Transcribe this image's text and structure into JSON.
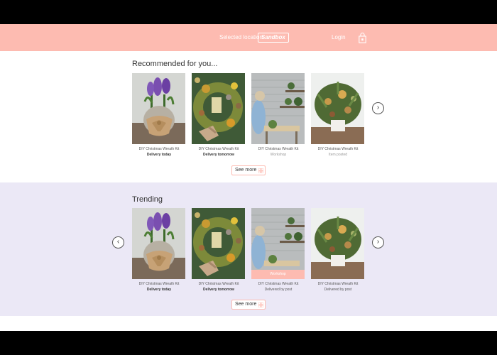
{
  "header": {
    "location_label": "Selected location",
    "location_value": "Sandbox",
    "login_label": "Login",
    "bag_icon": "shopping-bag-icon",
    "bg_color": "#fdbbb1"
  },
  "recommended": {
    "title": "Recommended for you...",
    "see_more_label": "See more",
    "cards": [
      {
        "name": "DIY Christmas Wreath Kit",
        "sub": "Delivery today",
        "image": "hyacinth-pot"
      },
      {
        "name": "DIY Christmas Wreath Kit",
        "sub": "Delivery tomorrow",
        "image": "wreath"
      },
      {
        "name": "DIY Christmas Wreath Kit",
        "sub": "Workshop",
        "image": "workshop"
      },
      {
        "name": "DIY Christmas Wreath Kit",
        "sub": "Item posted",
        "image": "bouquet"
      }
    ]
  },
  "trending": {
    "title": "Trending",
    "see_more_label": "See more",
    "bg_color": "#ebe8f6",
    "cards": [
      {
        "name": "DIY Christmas Wreath Kit",
        "sub": "Delivery today",
        "image": "hyacinth-pot"
      },
      {
        "name": "DIY Christmas Wreath Kit",
        "sub": "Delivery tomorrow",
        "image": "wreath"
      },
      {
        "name": "DIY Christmas Wreath Kit",
        "sub": "Delivered by post",
        "image": "workshop",
        "tag": "Workshop"
      },
      {
        "name": "DIY Christmas Wreath Kit",
        "sub": "Delivered by post",
        "image": "bouquet"
      }
    ]
  }
}
